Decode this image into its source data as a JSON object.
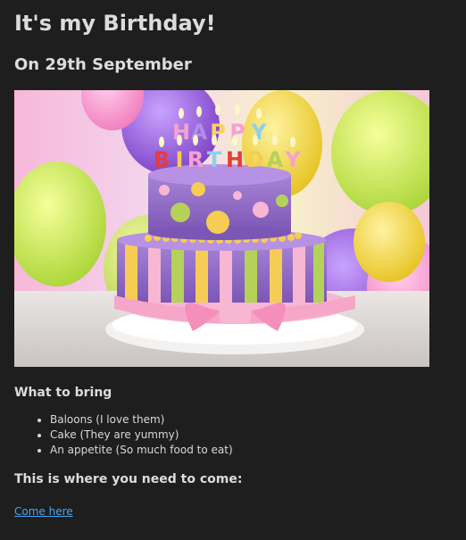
{
  "page": {
    "title": "It's my Birthday!",
    "date_heading": "On 29th September",
    "bring_heading": "What to bring",
    "bring_items": [
      "Baloons (I love them)",
      "Cake (They are yummy)",
      "An appetite (So much food to eat)"
    ],
    "where_heading": "This is where you need to come:",
    "link_text": "Come here"
  },
  "image": {
    "candle_text": [
      "HAPPY",
      "BIRTHDAY"
    ]
  },
  "colors": {
    "background": "#1e1e1e",
    "text": "#dcdcdc",
    "link": "#4aa3f0"
  }
}
